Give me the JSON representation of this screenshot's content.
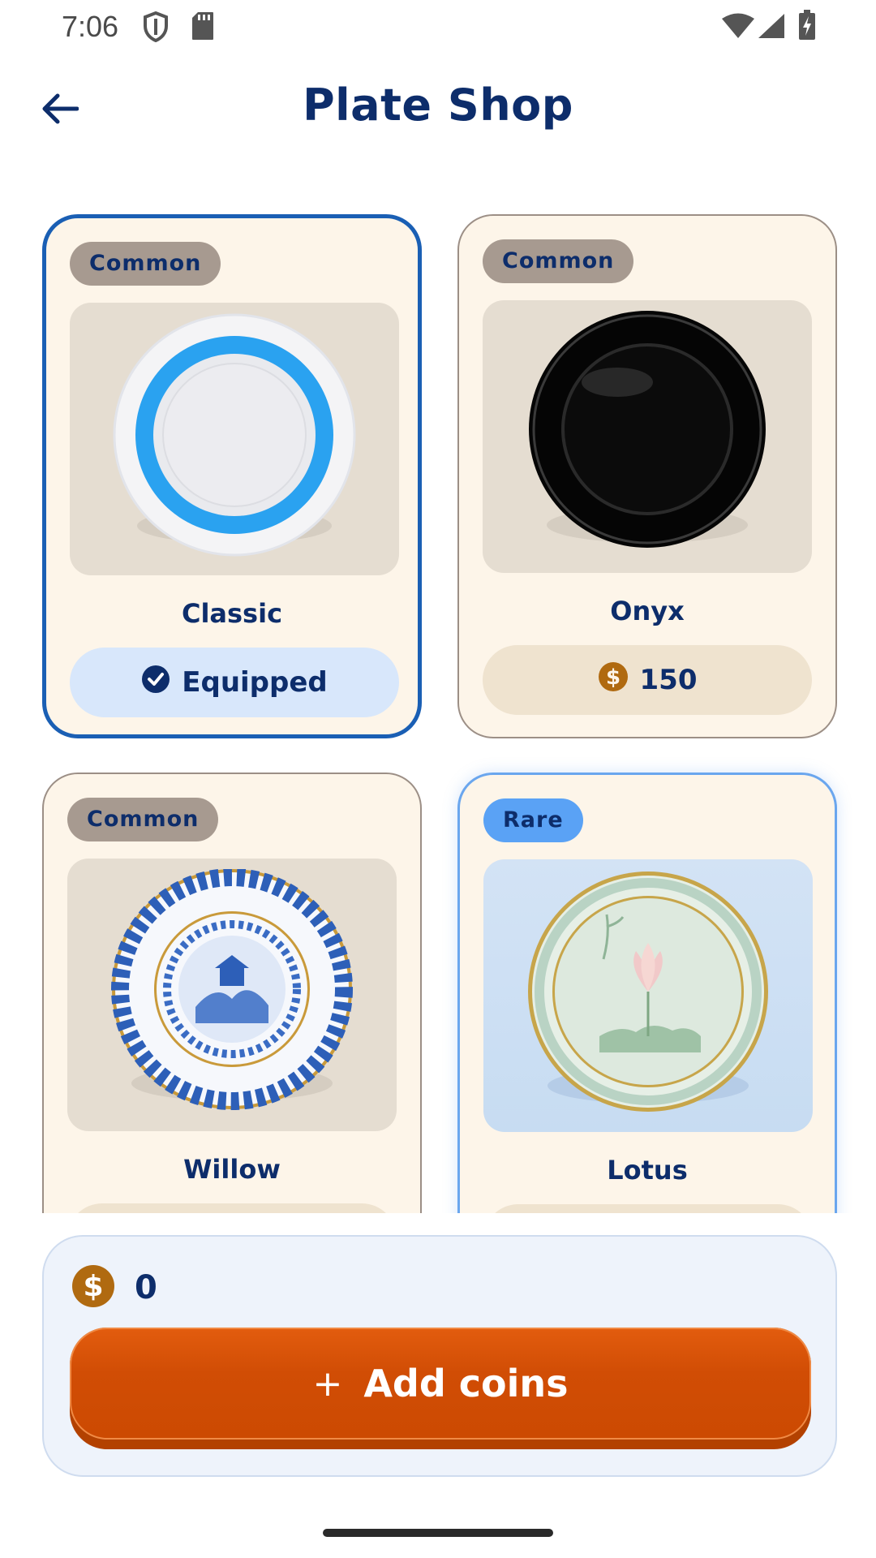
{
  "status_bar": {
    "time": "7:06",
    "left_icons": [
      "shield-icon",
      "sd-card-icon"
    ],
    "right_icons": [
      "wifi-icon",
      "signal-icon",
      "battery-charging-icon"
    ]
  },
  "header": {
    "title": "Plate Shop",
    "back_icon": "arrow-left-icon"
  },
  "plates": [
    {
      "rarity": "Common",
      "name": "Classic",
      "status": "Equipped",
      "status_icon": "check-circle-icon"
    },
    {
      "rarity": "Common",
      "name": "Onyx",
      "price": "150",
      "price_icon": "coin-icon"
    },
    {
      "rarity": "Common",
      "name": "Willow"
    },
    {
      "rarity": "Rare",
      "name": "Lotus"
    }
  ],
  "wallet": {
    "coin_icon": "coin-icon",
    "balance": "0",
    "add_button_label": "Add coins",
    "add_button_icon": "plus-icon"
  },
  "colors": {
    "title": "#0d2d6b",
    "equipped_border": "#1a5fb4",
    "rare_badge": "#5aa2f5",
    "common_badge": "#a79a90",
    "add_button": "#d14d05",
    "card_bg": "#fdf5e9",
    "coin": "#b06a10"
  }
}
